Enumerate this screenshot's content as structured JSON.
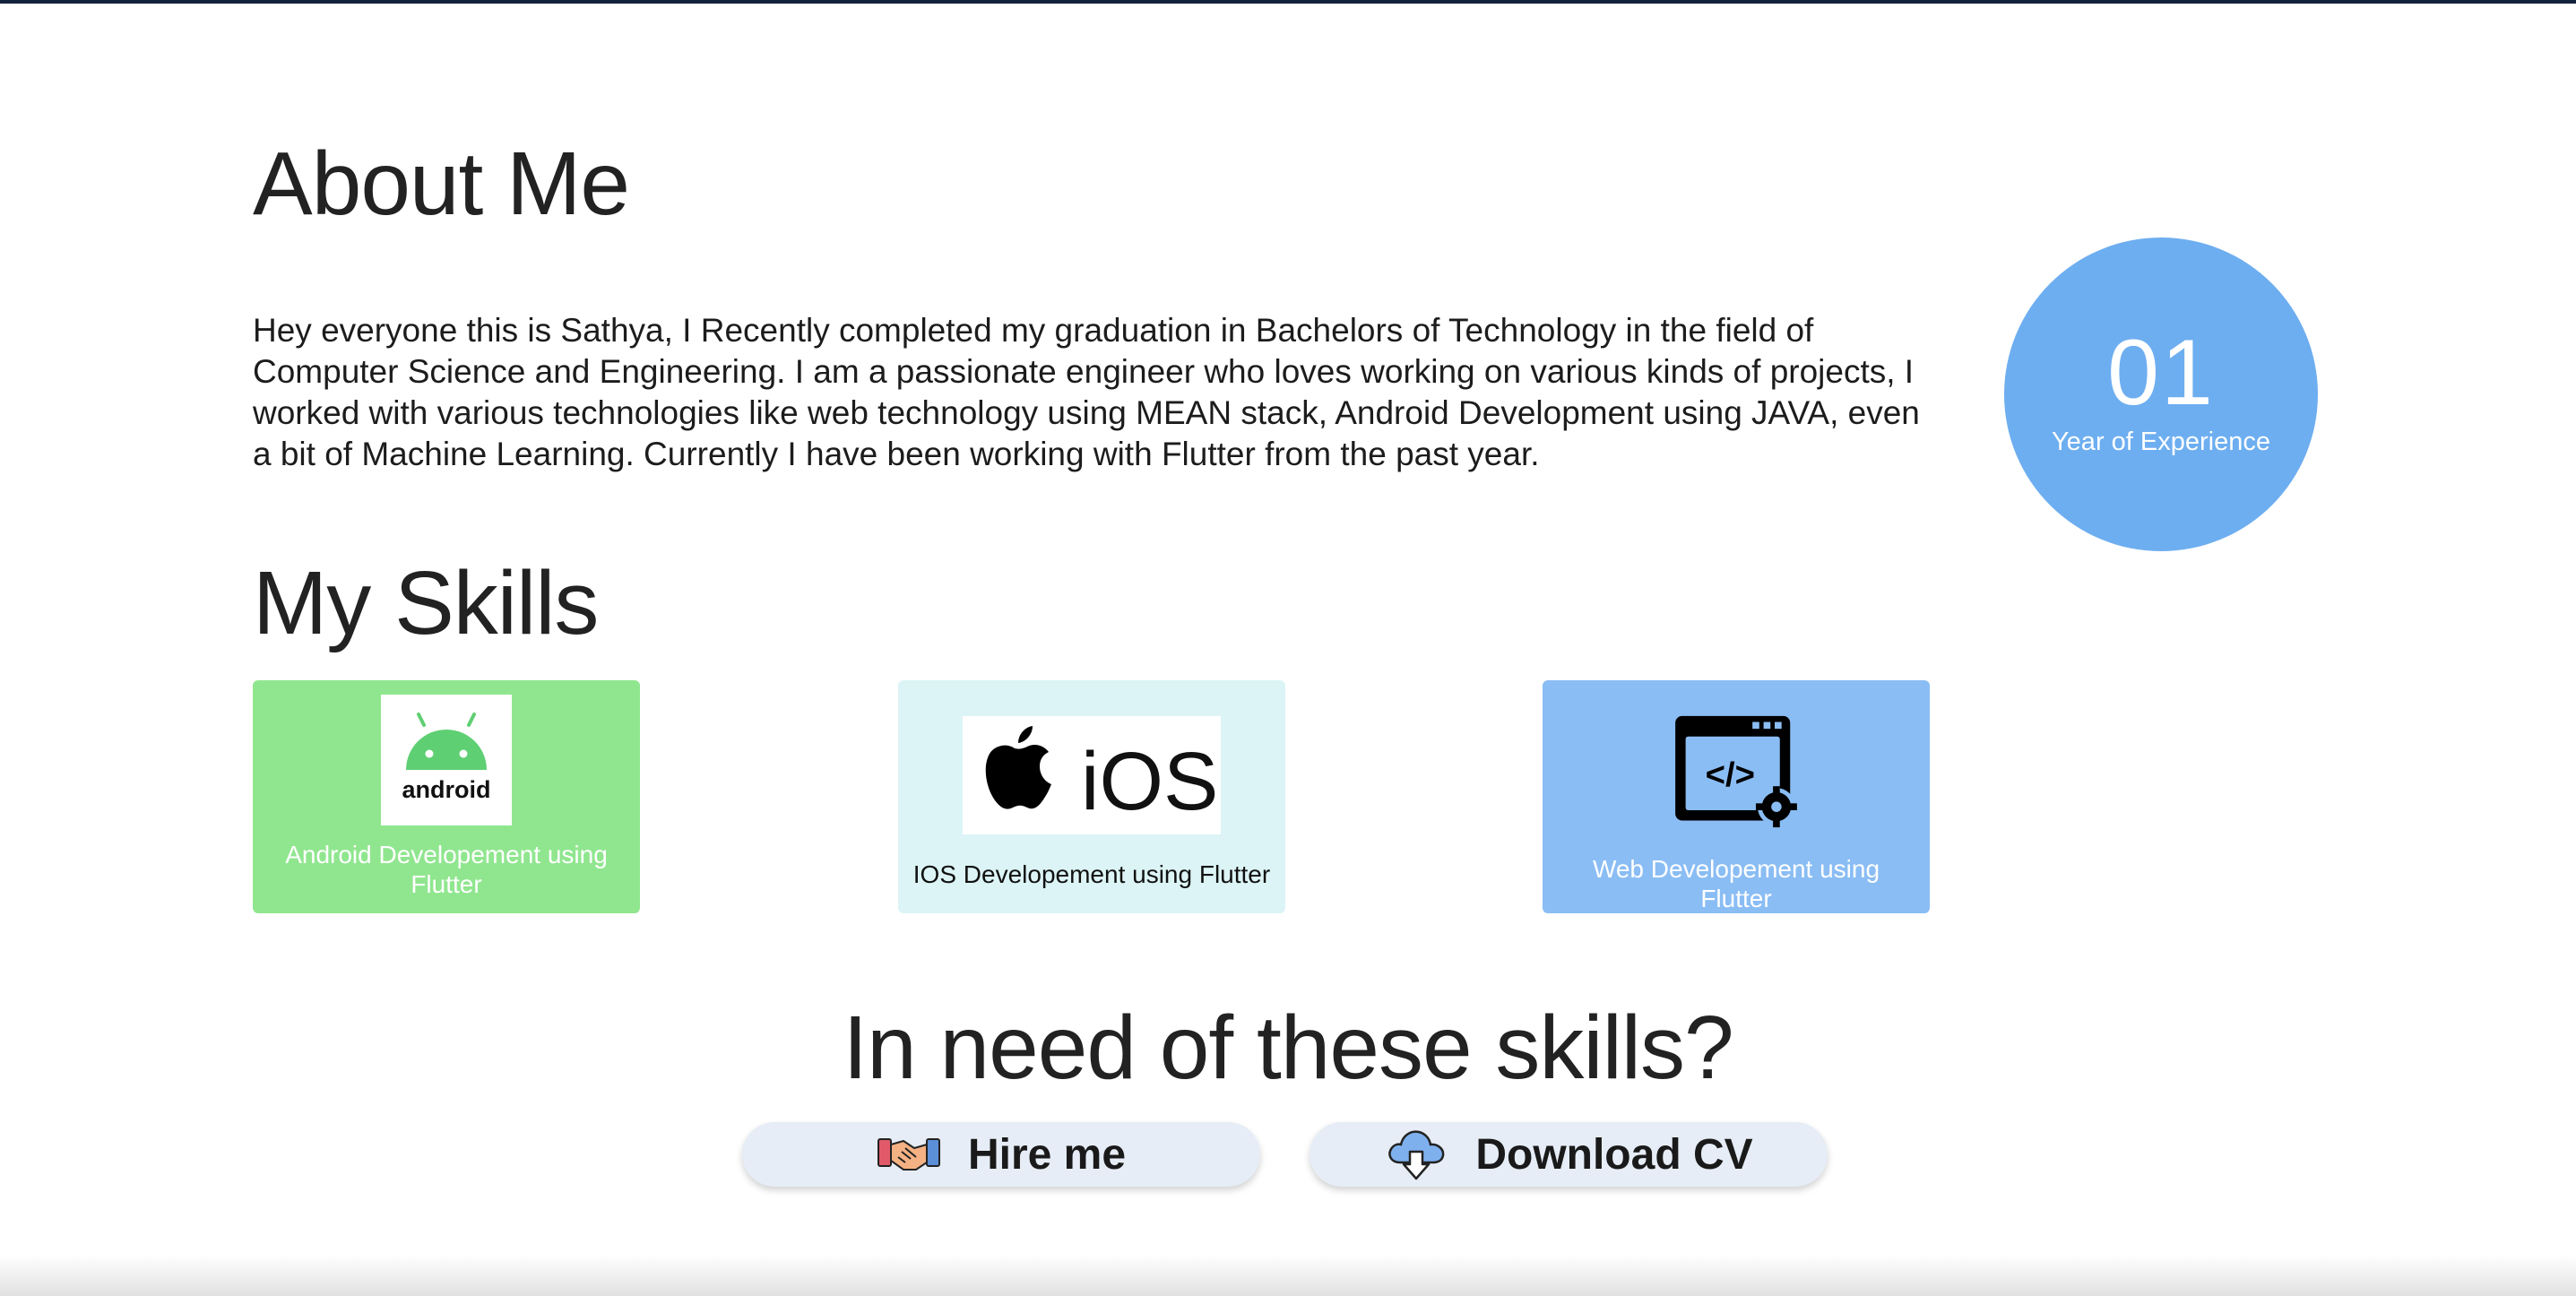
{
  "about": {
    "title": "About Me",
    "text": "Hey everyone this is Sathya, I Recently completed my graduation in Bachelors of Technology in the field of Computer Science and Engineering. I am a passionate engineer who loves working on various kinds of projects, I worked with various technologies like web technology using MEAN stack, Android Development using JAVA, even a bit of Machine Learning. Currently I have been working with Flutter from the past year."
  },
  "experience": {
    "number": "01",
    "label": "Year of Experience",
    "color": "#6daef0"
  },
  "skills": {
    "title": "My Skills",
    "items": [
      {
        "label": "Android Developement using Flutter",
        "logo_text": "android",
        "icon": "android-logo-icon",
        "color": "#90e68f"
      },
      {
        "label": "IOS Developement using Flutter",
        "logo_text": "iOS",
        "icon": "apple-ios-logo-icon",
        "color": "#dcf4f5"
      },
      {
        "label": "Web Developement using Flutter",
        "icon": "web-code-gear-icon",
        "color": "#8abdf4"
      }
    ]
  },
  "cta": {
    "title": "In need of these skills?",
    "hire_label": "Hire me",
    "hire_icon": "handshake-icon",
    "cv_label": "Download CV",
    "cv_icon": "cloud-download-icon"
  }
}
